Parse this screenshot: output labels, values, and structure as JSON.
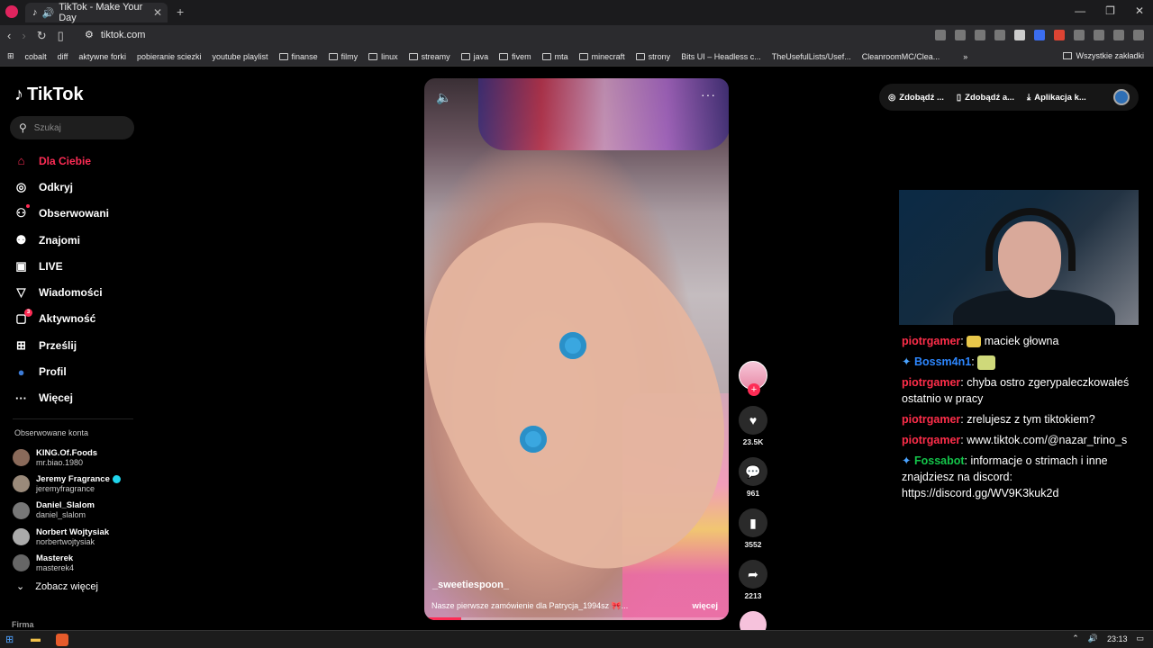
{
  "browser": {
    "tab_title": "TikTok - Make Your Day",
    "tab_close": "✕",
    "new_tab": "+",
    "url": "tiktok.com",
    "window_controls": [
      "—",
      "❐",
      "✕"
    ],
    "bookmarks": [
      "cobalt",
      "diff",
      "aktywne forki",
      "pobieranie sciezki",
      "youtube playlist",
      "finanse",
      "filmy",
      "linux",
      "streamy",
      "java",
      "fivem",
      "mta",
      "minecraft",
      "strony",
      "Bits UI – Headless c...",
      "TheUsefulLists/Usef...",
      "CleanroomMC/Clea..."
    ],
    "bookmarks_overflow": "»",
    "all_bookmarks": "Wszystkie zakładki"
  },
  "tiktok": {
    "logo": "TikTok",
    "search_placeholder": "Szukaj",
    "nav": [
      {
        "label": "Dla Ciebie",
        "icon": "home-icon",
        "glyph": "⌂"
      },
      {
        "label": "Odkryj",
        "icon": "compass-icon",
        "glyph": "◎"
      },
      {
        "label": "Obserwowani",
        "icon": "following-icon",
        "glyph": "⚇"
      },
      {
        "label": "Znajomi",
        "icon": "friends-icon",
        "glyph": "⚉"
      },
      {
        "label": "LIVE",
        "icon": "live-icon",
        "glyph": "▣"
      },
      {
        "label": "Wiadomości",
        "icon": "messages-icon",
        "glyph": "▽"
      },
      {
        "label": "Aktywność",
        "icon": "activity-icon",
        "glyph": "▢",
        "badge": "3"
      },
      {
        "label": "Prześlij",
        "icon": "upload-icon",
        "glyph": "⊞"
      },
      {
        "label": "Profil",
        "icon": "profile-icon",
        "glyph": "●"
      },
      {
        "label": "Więcej",
        "icon": "more-icon",
        "glyph": "···"
      }
    ],
    "followed_title": "Obserwowane konta",
    "followed": [
      {
        "name": "KING.Of.Foods",
        "handle": "mr.biao.1980",
        "verified": false
      },
      {
        "name": "Jeremy Fragrance",
        "handle": "jeremyfragrance",
        "verified": true
      },
      {
        "name": "Daniel_Slalom",
        "handle": "daniel_slalom",
        "verified": false
      },
      {
        "name": "Norbert Wojtysiak",
        "handle": "norbertwojtysiak",
        "verified": false
      },
      {
        "name": "Masterek",
        "handle": "masterek4",
        "verified": false
      }
    ],
    "see_more": "Zobacz więcej",
    "footer_heading": "Firma",
    "topbar": [
      "Zdobądź ...",
      "Zdobądź a...",
      "Aplikacja k..."
    ],
    "video": {
      "author": "_sweetiespoon_",
      "caption": "Nasze pierwsze zamówienie dla Patrycja_1994sz 🎀...",
      "more_label": "więcej",
      "progress": 0.12,
      "likes": "23.5K",
      "comments": "961",
      "saves": "3552",
      "shares": "2213"
    }
  },
  "chat": [
    {
      "user": "piotrgamer",
      "color": "red",
      "text": "maciek głowna",
      "emote": true
    },
    {
      "user": "Bossm4n1",
      "color": "blue",
      "text": "",
      "emote": true,
      "mod": true
    },
    {
      "user": "piotrgamer",
      "color": "red",
      "text": "chyba ostro zgerypaleczkowałeś ostatnio w pracy"
    },
    {
      "user": "piotrgamer",
      "color": "red",
      "text": "zrelujesz z tym tiktokiem?"
    },
    {
      "user": "piotrgamer",
      "color": "red",
      "text": "www.tiktok.com/@nazar_trino_s"
    },
    {
      "user": "Fossabot",
      "color": "green",
      "text": "informacje o strimach i inne znajdziesz na discord: https://discord.gg/WV9K3kuk2d",
      "mod": true
    }
  ],
  "taskbar": {
    "time": "23:13"
  }
}
